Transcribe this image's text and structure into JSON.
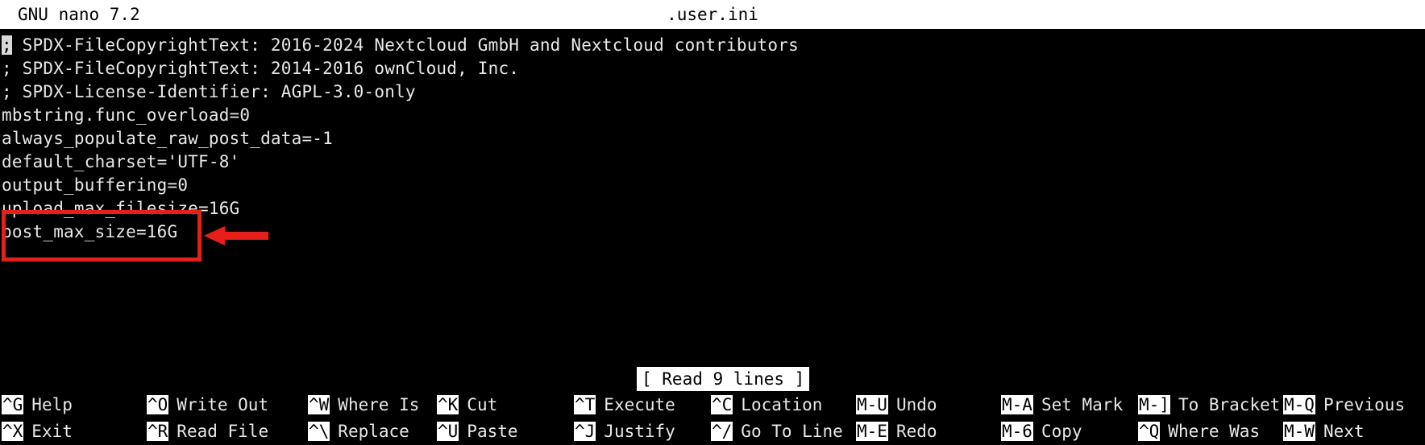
{
  "titlebar": {
    "version": "GNU nano 7.2",
    "filename": ".user.ini"
  },
  "editor": {
    "lines": [
      {
        "cursor_char": ";",
        "text": " SPDX-FileCopyrightText: 2016-2024 Nextcloud GmbH and Nextcloud contributors"
      },
      {
        "cursor_char": "",
        "text": "; SPDX-FileCopyrightText: 2014-2016 ownCloud, Inc."
      },
      {
        "cursor_char": "",
        "text": "; SPDX-License-Identifier: AGPL-3.0-only"
      },
      {
        "cursor_char": "",
        "text": "mbstring.func_overload=0"
      },
      {
        "cursor_char": "",
        "text": "always_populate_raw_post_data=-1"
      },
      {
        "cursor_char": "",
        "text": "default_charset='UTF-8'"
      },
      {
        "cursor_char": "",
        "text": "output_buffering=0"
      },
      {
        "cursor_char": "",
        "text": "upload_max_filesize=16G"
      },
      {
        "cursor_char": "",
        "text": "post_max_size=16G"
      }
    ]
  },
  "annotation": {
    "color": "#e81f19",
    "highlighted_lines": [
      "upload_max_filesize=16G",
      "post_max_size=16G"
    ]
  },
  "status": {
    "message": "[ Read 9 lines ]"
  },
  "shortcuts": {
    "row1": [
      {
        "key": "^G",
        "label": "Help"
      },
      {
        "key": "^O",
        "label": "Write Out"
      },
      {
        "key": "^W",
        "label": "Where Is"
      },
      {
        "key": "^K",
        "label": "Cut"
      },
      {
        "key": "^T",
        "label": "Execute"
      },
      {
        "key": "^C",
        "label": "Location"
      },
      {
        "key": "M-U",
        "label": "Undo"
      },
      {
        "key": "M-A",
        "label": "Set Mark"
      },
      {
        "key": "M-]",
        "label": "To Bracket"
      },
      {
        "key": "M-Q",
        "label": "Previous"
      }
    ],
    "row2": [
      {
        "key": "^X",
        "label": "Exit"
      },
      {
        "key": "^R",
        "label": "Read File"
      },
      {
        "key": "^\\",
        "label": "Replace"
      },
      {
        "key": "^U",
        "label": "Paste"
      },
      {
        "key": "^J",
        "label": "Justify"
      },
      {
        "key": "^/",
        "label": "Go To Line"
      },
      {
        "key": "M-E",
        "label": "Redo"
      },
      {
        "key": "M-6",
        "label": "Copy"
      },
      {
        "key": "^Q",
        "label": "Where Was"
      },
      {
        "key": "M-W",
        "label": "Next"
      }
    ]
  }
}
